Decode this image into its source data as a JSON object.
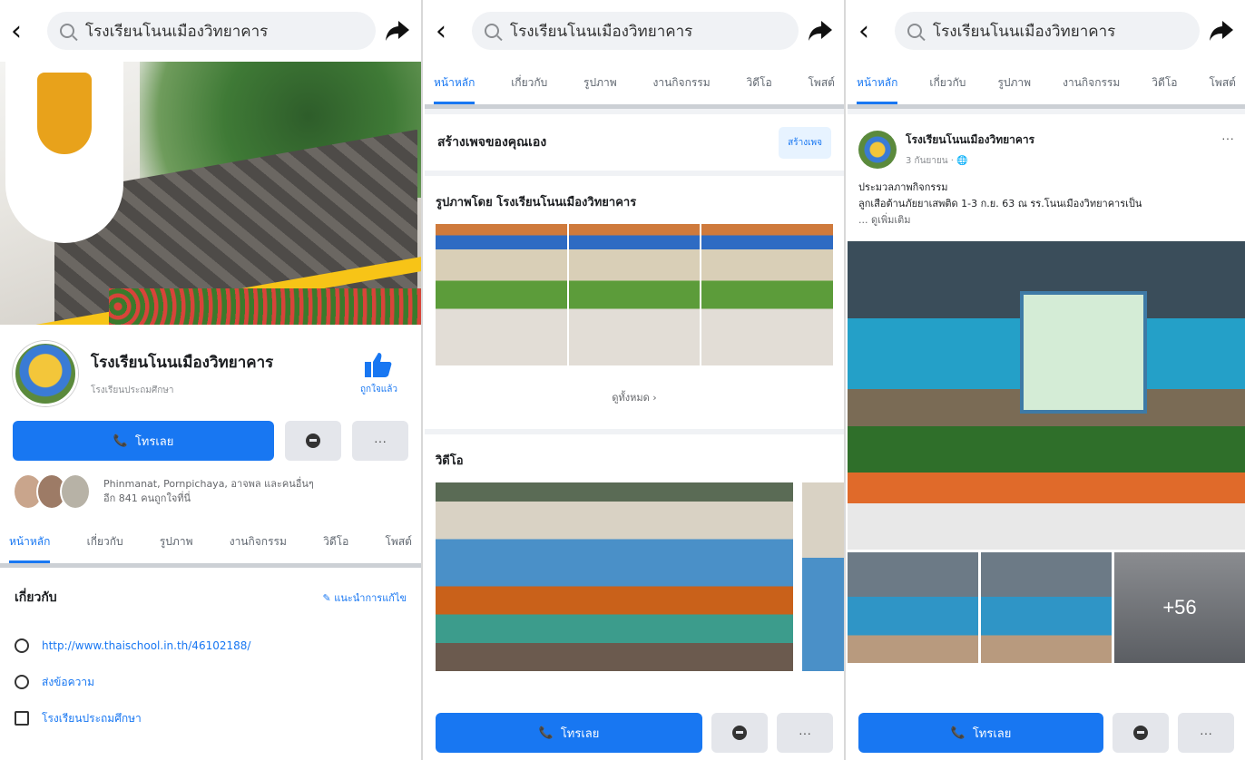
{
  "page": {
    "name": "โรงเรียนโนนเมืองวิทยาคาร",
    "category": "โรงเรียนประถมศึกษา"
  },
  "search": {
    "query": "โรงเรียนโนนเมืองวิทยาคาร"
  },
  "tabs": [
    "หน้าหลัก",
    "เกี่ยวกับ",
    "รูปภาพ",
    "งานกิจกรรม",
    "วิดีโอ",
    "โพสต์"
  ],
  "actions": {
    "call": "โทรเลย",
    "like": "ถูกใจแล้ว",
    "more": "···"
  },
  "friends": {
    "text_line1": "Phinmanat, Pornpichaya, อาจพล และคนอื่นๆ",
    "text_line2": "อีก 841 คนถูกใจที่นี่"
  },
  "about": {
    "title": "เกี่ยวกับ",
    "edit": "แนะนำการแก้ไข",
    "website": "http://www.thaischool.in.th/46102188/",
    "message": "ส่งข้อความ",
    "category": "โรงเรียนประถมศึกษา"
  },
  "panel2": {
    "create_page": "สร้างเพจของคุณเอง",
    "create_button": "สร้างเพจ",
    "photos_title": "รูปภาพโดย โรงเรียนโนนเมืองวิทยาคาร",
    "see_all": "ดูทั้งหมด ›",
    "video_title": "วิดีโอ"
  },
  "post": {
    "author": "โรงเรียนโนนเมืองวิทยาคาร",
    "date": "3 กันยายน · 🌐",
    "menu": "···",
    "line1": "ประมวลภาพกิจกรรม",
    "line2": "ลูกเสือต้านภัยยาเสพติด 1-3 ก.ย. 63 ณ รร.โนนเมืองวิทยาคารเป็น",
    "more": "... ดูเพิ่มเติม",
    "extra_photos": "+56"
  },
  "colors": {
    "accent": "#1877f2",
    "background": "#f0f2f5"
  }
}
